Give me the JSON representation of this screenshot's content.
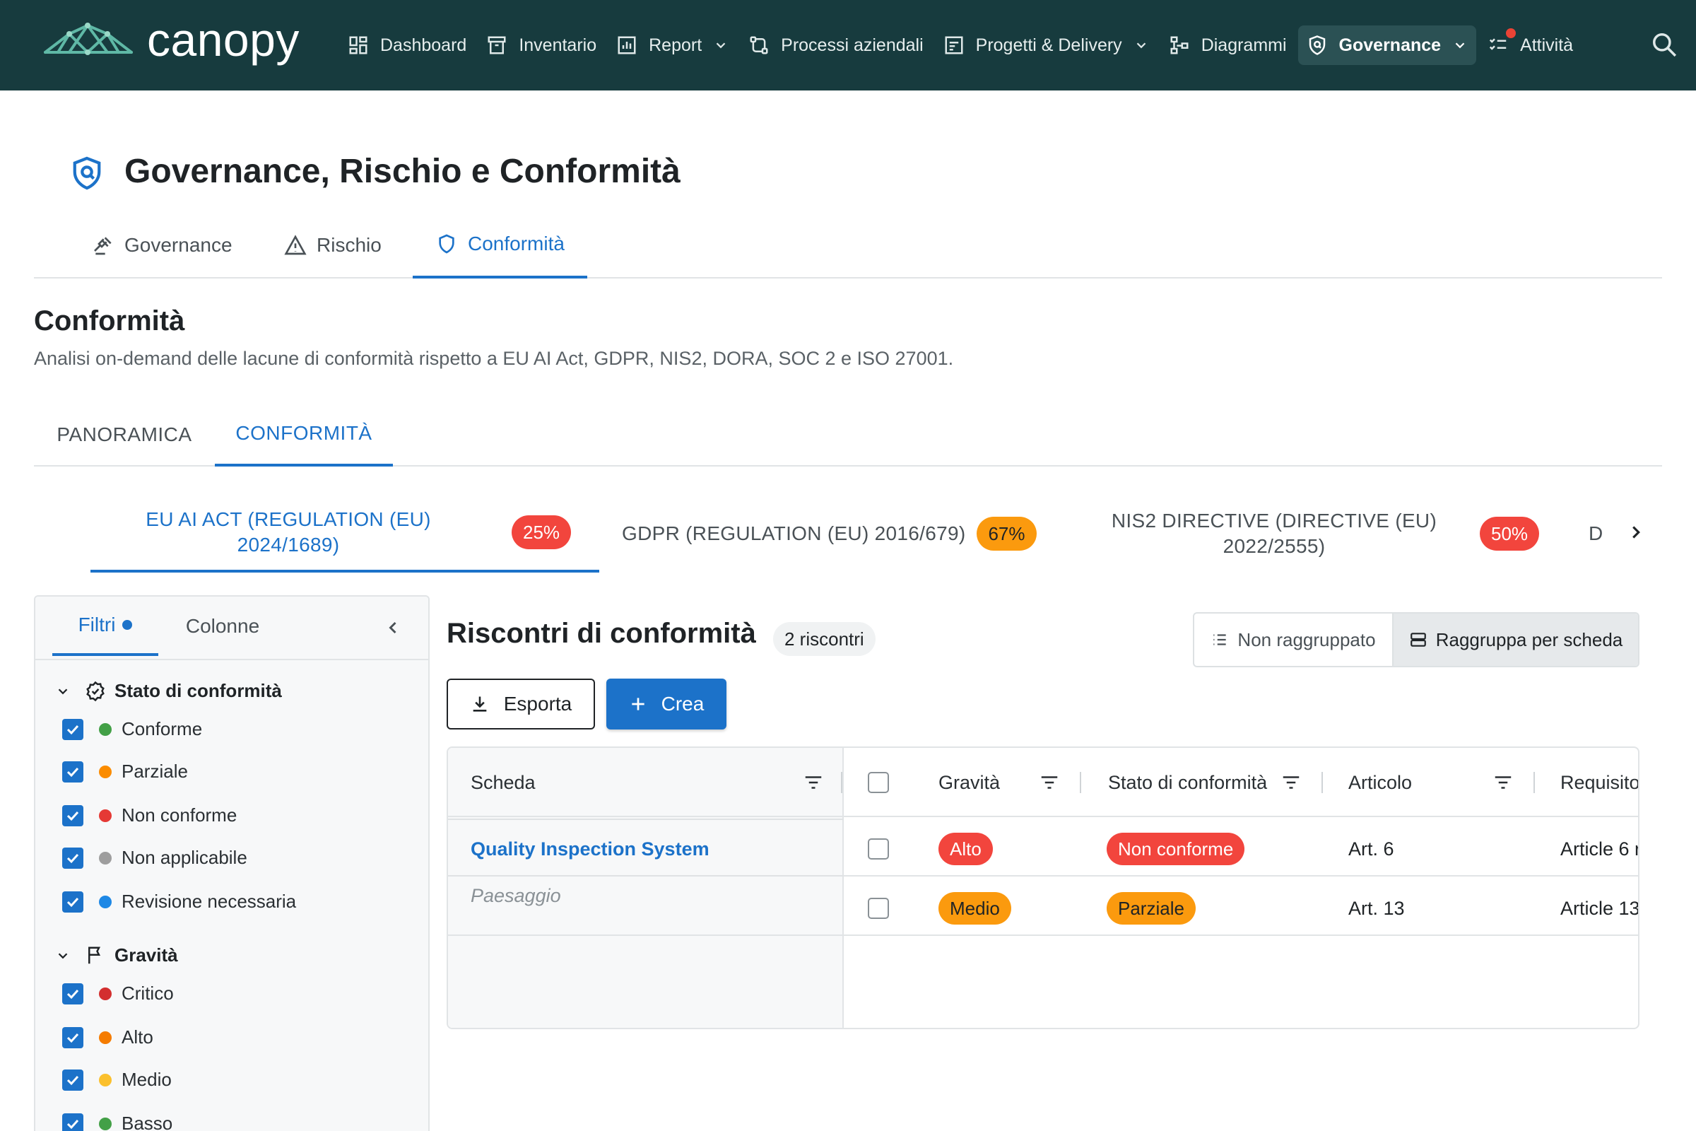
{
  "brand": {
    "name": "canopy"
  },
  "nav": {
    "items": [
      {
        "label": "Dashboard",
        "icon": "dashboard-icon"
      },
      {
        "label": "Inventario",
        "icon": "archive-icon"
      },
      {
        "label": "Report",
        "icon": "report-icon",
        "has_dropdown": true
      },
      {
        "label": "Processi aziendali",
        "icon": "process-icon"
      },
      {
        "label": "Progetti & Delivery",
        "icon": "project-icon",
        "has_dropdown": true
      },
      {
        "label": "Diagrammi",
        "icon": "diagram-icon"
      },
      {
        "label": "Governance",
        "icon": "shield-icon",
        "has_dropdown": true,
        "active": true
      },
      {
        "label": "Attività",
        "icon": "checklist-icon",
        "has_notification": true
      }
    ],
    "search_icon": "search-icon"
  },
  "page": {
    "title": "Governance, Rischio e Conformità",
    "subnav": [
      {
        "label": "Governance",
        "icon": "gavel-icon"
      },
      {
        "label": "Rischio",
        "icon": "warning-icon"
      },
      {
        "label": "Conformità",
        "icon": "shield-outline-icon",
        "active": true
      }
    ]
  },
  "section": {
    "title": "Conformità",
    "description": "Analisi on-demand delle lacune di conformità rispetto a EU AI Act, GDPR, NIS2, DORA, SOC 2 e ISO 27001.",
    "tabs": [
      {
        "label": "PANORAMICA"
      },
      {
        "label": "CONFORMITÀ",
        "active": true
      }
    ]
  },
  "frameworks": [
    {
      "name_line1": "EU AI ACT (REGULATION (EU)",
      "name_line2": "2024/1689)",
      "percent": "25%",
      "color": "#f2453d",
      "active": true
    },
    {
      "name_line1": "GDPR (REGULATION (EU) 2016/679)",
      "name_line2": "",
      "percent": "67%",
      "color": "#fb9a0e"
    },
    {
      "name_line1": "NIS2 DIRECTIVE (DIRECTIVE (EU)",
      "name_line2": "2022/2555)",
      "percent": "50%",
      "color": "#f2453d"
    },
    {
      "name_line1": "D",
      "name_line2": ""
    }
  ],
  "filters": {
    "tabs": {
      "filters": "Filtri",
      "columns": "Colonne"
    },
    "groups": [
      {
        "title": "Stato di conformità",
        "icon": "badge-check-icon",
        "options": [
          {
            "label": "Conforme",
            "color": "#43a047"
          },
          {
            "label": "Parziale",
            "color": "#fb8c00"
          },
          {
            "label": "Non conforme",
            "color": "#e53935"
          },
          {
            "label": "Non applicabile",
            "color": "#9e9e9e"
          },
          {
            "label": "Revisione necessaria",
            "color": "#1e88e5"
          }
        ]
      },
      {
        "title": "Gravità",
        "icon": "flag-icon",
        "options": [
          {
            "label": "Critico",
            "color": "#d32f2f"
          },
          {
            "label": "Alto",
            "color": "#f57c00"
          },
          {
            "label": "Medio",
            "color": "#fbc02d"
          },
          {
            "label": "Basso",
            "color": "#43a047"
          }
        ]
      }
    ]
  },
  "findings": {
    "title": "Riscontri di conformità",
    "count": "2 riscontri",
    "group_toggle": {
      "ungrouped": "Non raggruppato",
      "by_card": "Raggruppa per scheda",
      "active": "by_card"
    },
    "export_label": "Esporta",
    "create_label": "Crea",
    "columns": {
      "scheda": "Scheda",
      "gravita": "Gravità",
      "stato": "Stato di conformità",
      "articolo": "Articolo",
      "requisito": "Requisito"
    },
    "group": {
      "name": "Quality Inspection System",
      "type": "Paesaggio"
    },
    "rows": [
      {
        "gravita": "Alto",
        "gravita_color": "#f2453d",
        "gravita_text": "#ffffff",
        "stato": "Non conforme",
        "stato_color": "#f2453d",
        "stato_text": "#ffffff",
        "articolo": "Art. 6",
        "requisito": "Article 6 r"
      },
      {
        "gravita": "Medio",
        "gravita_color": "#fb9a0e",
        "gravita_text": "#1f2326",
        "stato": "Parziale",
        "stato_color": "#fb9a0e",
        "stato_text": "#1f2326",
        "articolo": "Art. 13",
        "requisito": "Article 13"
      }
    ]
  }
}
